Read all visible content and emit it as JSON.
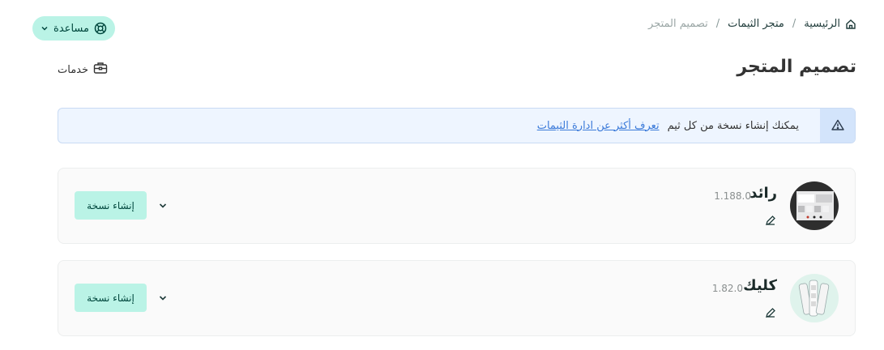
{
  "breadcrumb": {
    "home": "الرئيسية",
    "themes_store": "متجر الثيمات",
    "current": "تصميم المتجر",
    "separator": "/"
  },
  "help": {
    "label": "مساعدة"
  },
  "page": {
    "title": "تصميم المتجر"
  },
  "services": {
    "label": "خدمات"
  },
  "alert": {
    "text": "يمكنك إنشاء نسخة من كل ثيم",
    "link": "تعرف أكثر عن ادارة الثيمات"
  },
  "themes": [
    {
      "name": "رائد",
      "version": "1.188.0",
      "create_label": "إنشاء نسخة"
    },
    {
      "name": "كليك",
      "version": "1.82.0",
      "create_label": "إنشاء نسخة"
    }
  ],
  "colors": {
    "accent_bg": "#baf3e6",
    "accent_text": "#00473d",
    "alert_bg": "#eef5ff",
    "link": "#3b7ad9"
  },
  "icons": {
    "breadcrumb": "home-icon",
    "help": "lifebuoy-icon",
    "services": "toolbox-icon",
    "alert": "warning-icon",
    "edit": "pencil-icon",
    "expand": "chevron-down-icon"
  }
}
